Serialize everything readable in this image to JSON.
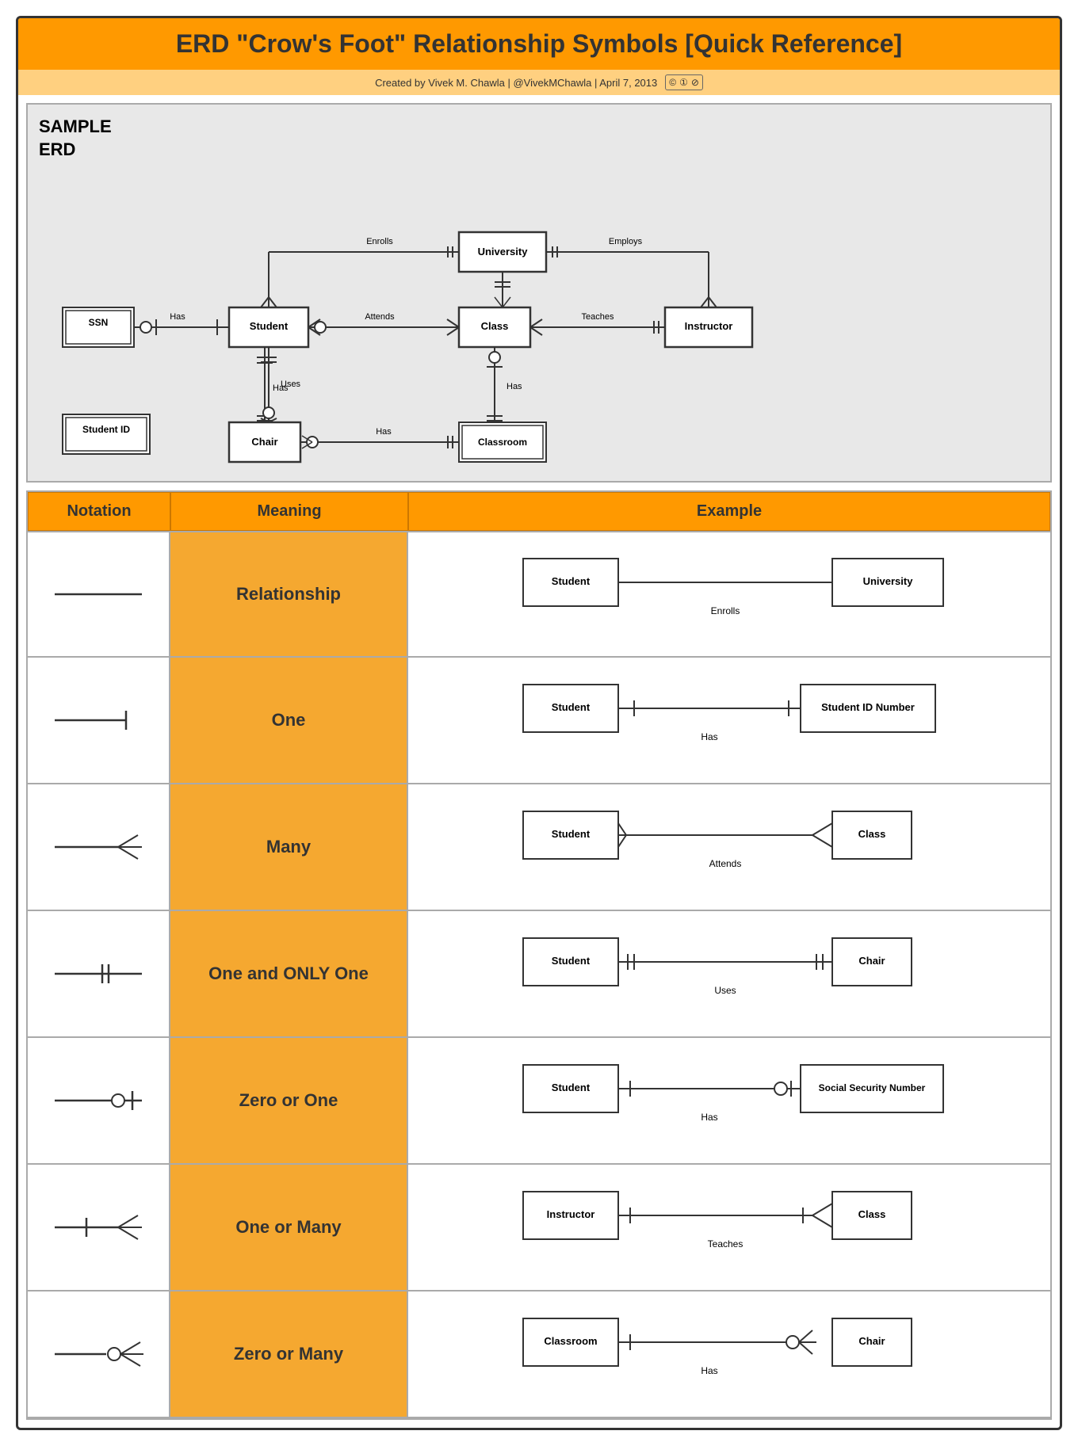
{
  "title": "ERD \"Crow's Foot\" Relationship Symbols [Quick Reference]",
  "credit": "Created by Vivek M. Chawla  |  @VivekMChawla  |  April 7, 2013",
  "sections": {
    "sampleErd": {
      "label": "SAMPLE\nERD"
    },
    "table": {
      "headers": [
        "Notation",
        "Meaning",
        "Example"
      ],
      "rows": [
        {
          "meaning": "Relationship",
          "example": {
            "left": "Student",
            "right": "University",
            "label": "Enrolls",
            "type": "relationship"
          }
        },
        {
          "meaning": "One",
          "example": {
            "left": "Student",
            "right": "Student ID Number",
            "label": "Has",
            "type": "one"
          }
        },
        {
          "meaning": "Many",
          "example": {
            "left": "Student",
            "right": "Class",
            "label": "Attends",
            "type": "many"
          }
        },
        {
          "meaning": "One and ONLY One",
          "example": {
            "left": "Student",
            "right": "Chair",
            "label": "Uses",
            "type": "one-only"
          }
        },
        {
          "meaning": "Zero or One",
          "example": {
            "left": "Student",
            "right": "Social Security Number",
            "label": "Has",
            "type": "zero-or-one"
          }
        },
        {
          "meaning": "One or Many",
          "example": {
            "left": "Instructor",
            "right": "Class",
            "label": "Teaches",
            "type": "one-or-many"
          }
        },
        {
          "meaning": "Zero or Many",
          "example": {
            "left": "Classroom",
            "right": "Chair",
            "label": "Has",
            "type": "zero-or-many"
          }
        }
      ]
    }
  }
}
